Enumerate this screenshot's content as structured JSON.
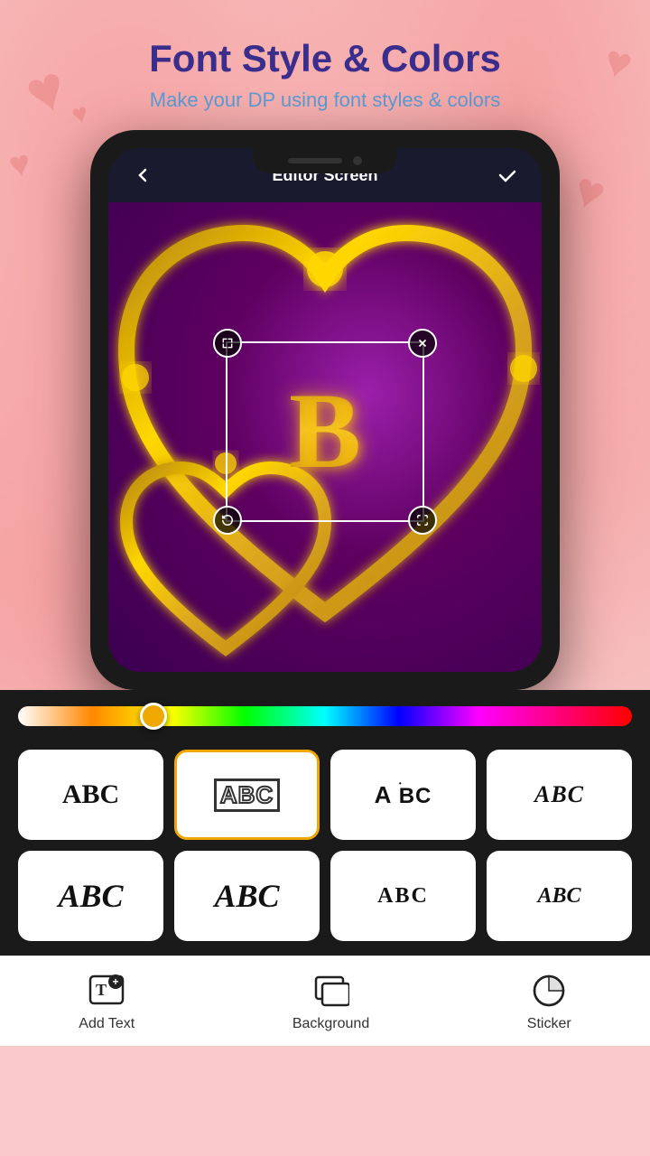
{
  "header": {
    "title": "Font Style & Colors",
    "subtitle": "Make your DP using font styles & colors"
  },
  "editor": {
    "title": "Editor Screen",
    "back_icon": "‹",
    "check_icon": "✓",
    "letter": "B"
  },
  "slider": {
    "label": "color-slider"
  },
  "fonts": [
    {
      "label": "ABC",
      "style": "serif-bold",
      "selected": false
    },
    {
      "label": "ABC",
      "style": "outlined",
      "selected": true
    },
    {
      "label": "ABC",
      "style": "dotted",
      "selected": false
    },
    {
      "label": "ABC",
      "style": "italic-wave",
      "selected": false
    },
    {
      "label": "ABC",
      "style": "cursive-1",
      "selected": false
    },
    {
      "label": "ABC",
      "style": "cursive-2",
      "selected": false
    },
    {
      "label": "ABC",
      "style": "thin-serif",
      "selected": false
    },
    {
      "label": "ABC",
      "style": "fancy-italic",
      "selected": false
    }
  ],
  "bottom_nav": {
    "items": [
      {
        "label": "Add Text",
        "icon": "add-text-icon"
      },
      {
        "label": "Background",
        "icon": "background-icon"
      },
      {
        "label": "Sticker",
        "icon": "sticker-icon"
      }
    ]
  }
}
